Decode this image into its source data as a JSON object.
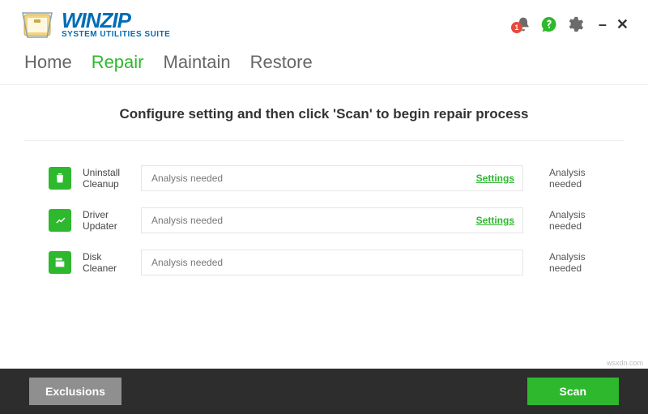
{
  "brand": {
    "name": "WINZIP",
    "subtitle": "SYSTEM UTILITIES SUITE"
  },
  "notifications": {
    "count": "1"
  },
  "tabs": [
    {
      "label": "Home",
      "active": false
    },
    {
      "label": "Repair",
      "active": true
    },
    {
      "label": "Maintain",
      "active": false
    },
    {
      "label": "Restore",
      "active": false
    }
  ],
  "instruction": "Configure setting and then click 'Scan' to begin repair process",
  "rows": [
    {
      "label": "Uninstall Cleanup",
      "bar_text": "Analysis needed",
      "settings": "Settings",
      "status": "Analysis needed"
    },
    {
      "label": "Driver Updater",
      "bar_text": "Analysis needed",
      "settings": "Settings",
      "status": "Analysis needed"
    },
    {
      "label": "Disk Cleaner",
      "bar_text": "Analysis needed",
      "settings": "",
      "status": "Analysis needed"
    }
  ],
  "footer": {
    "exclusions": "Exclusions",
    "scan": "Scan"
  },
  "watermark": "wsxdn.com"
}
